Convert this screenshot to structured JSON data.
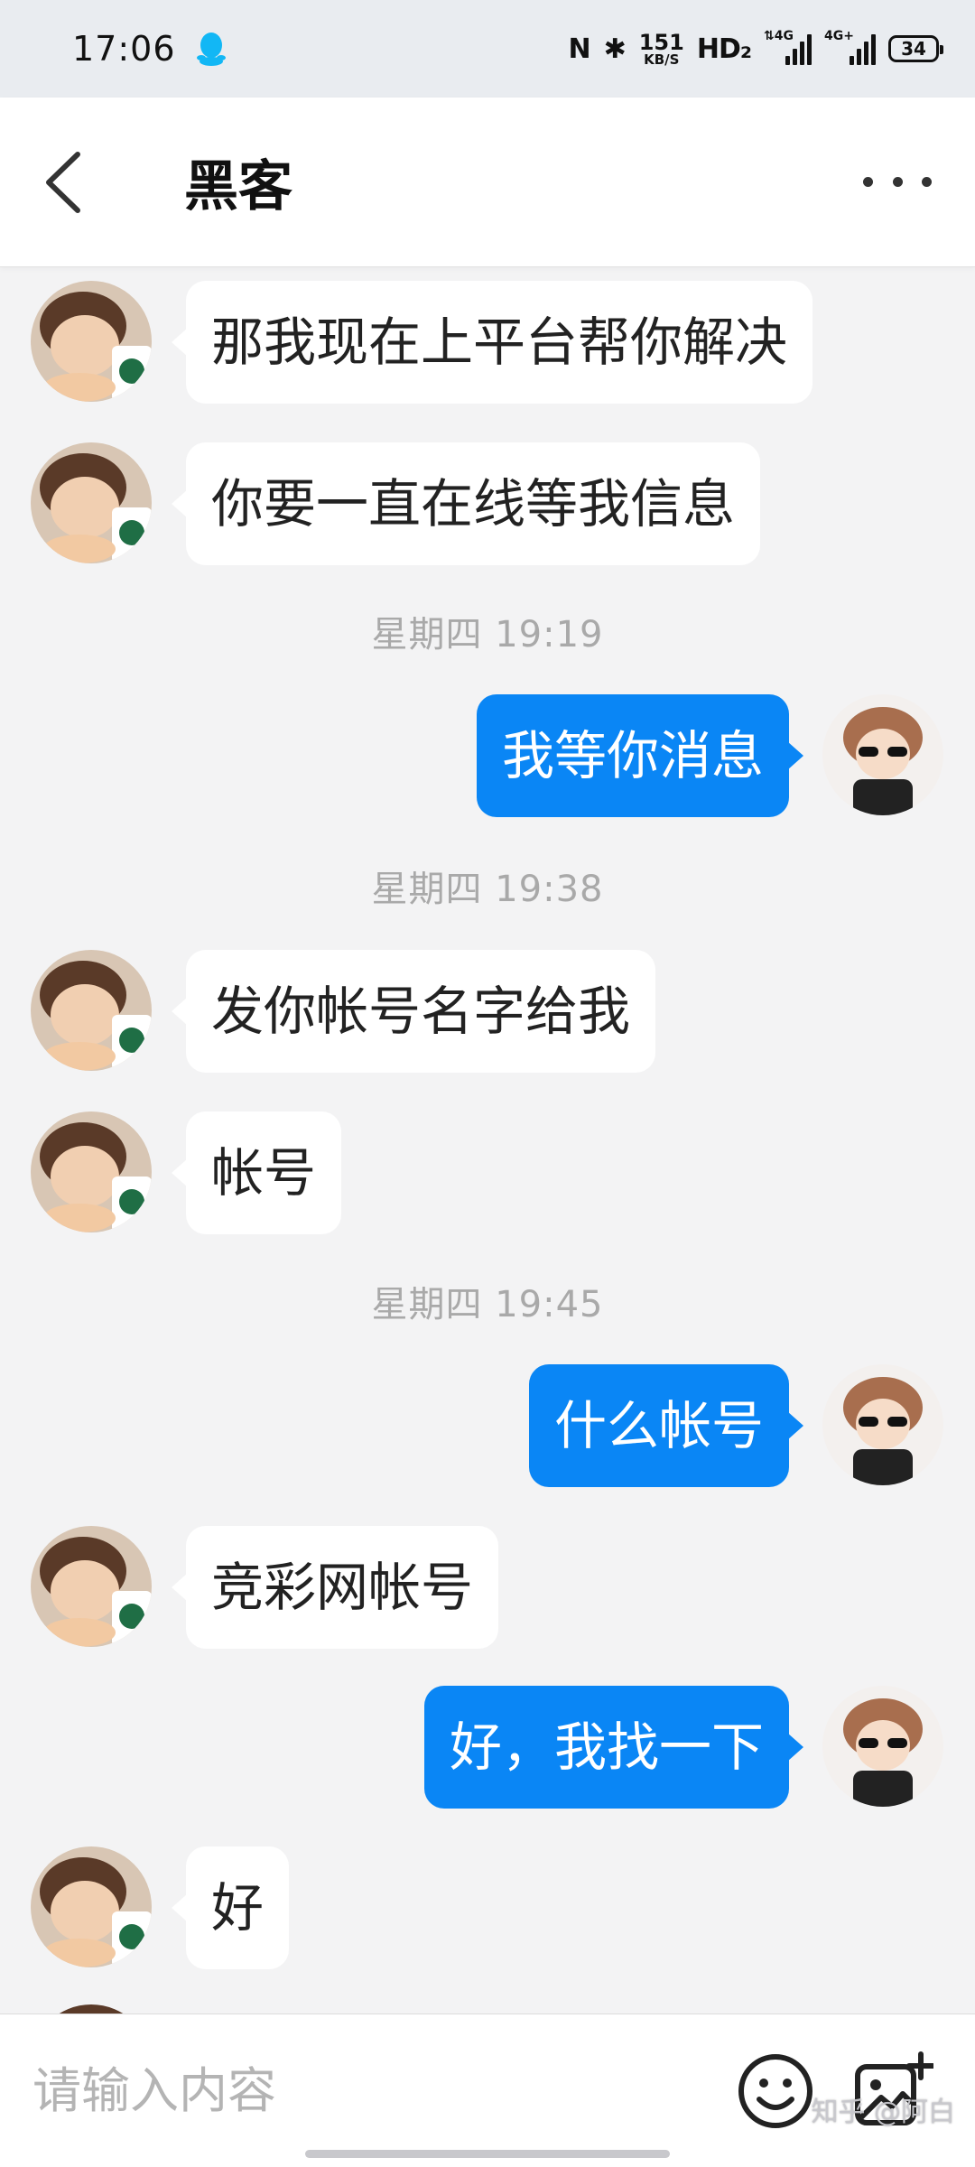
{
  "status_bar": {
    "time": "17:06",
    "nfc": "N",
    "bluetooth": "✱",
    "net_speed_value": "151",
    "net_speed_unit": "KB/S",
    "hd": "HD₂",
    "sim1_label": "⇅4G",
    "sim2_label": "4G+",
    "battery": "34"
  },
  "header": {
    "title": "黑客"
  },
  "messages": [
    {
      "side": "in",
      "text": "那我现在上平台帮你解决"
    },
    {
      "side": "in",
      "text": "你要一直在线等我信息"
    },
    {
      "timestamp": "星期四 19:19"
    },
    {
      "side": "out",
      "text": "我等你消息"
    },
    {
      "timestamp": "星期四 19:38"
    },
    {
      "side": "in",
      "text": "发你帐号名字给我"
    },
    {
      "side": "in",
      "text": "帐号"
    },
    {
      "timestamp": "星期四 19:45"
    },
    {
      "side": "out",
      "text": "什么帐号"
    },
    {
      "side": "in",
      "text": "竞彩网帐号"
    },
    {
      "side": "out",
      "text": "好，我找一下"
    },
    {
      "side": "in",
      "text": "好"
    }
  ],
  "input": {
    "placeholder": "请输入内容"
  },
  "watermark": "知乎 @阿白",
  "colors": {
    "outgoing_bubble": "#0a86f5",
    "incoming_bubble": "#ffffff",
    "background": "#f3f3f4"
  }
}
